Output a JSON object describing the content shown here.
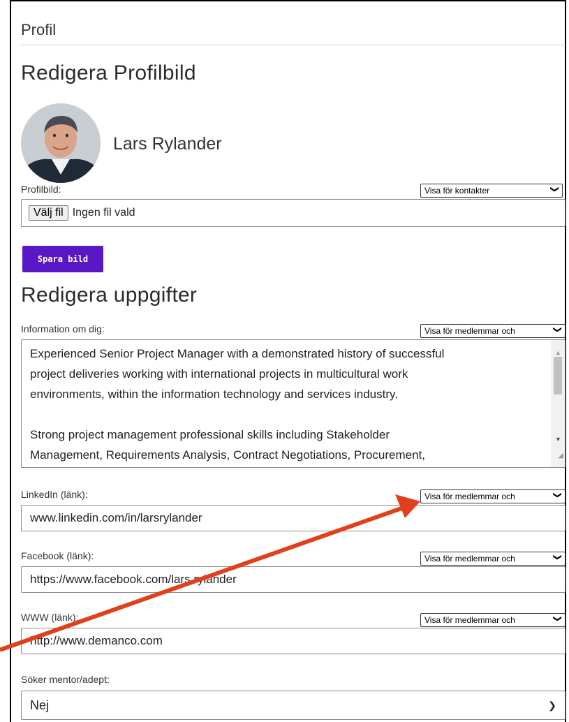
{
  "page": {
    "tab_title": "Profil"
  },
  "photo_section": {
    "heading": "Redigera Profilbild",
    "user_name": "Lars Rylander",
    "label": "Profilbild:",
    "visibility": "Visa för kontakter",
    "file_button": "Välj fil",
    "file_status": "Ingen fil vald",
    "save_button": "Spara bild"
  },
  "details_section": {
    "heading": "Redigera uppgifter",
    "about": {
      "label": "Information om dig:",
      "visibility": "Visa för medlemmar och",
      "lines": [
        "Experienced Senior Project Manager with a demonstrated history of successful",
        "project deliveries working with international projects in multicultural work",
        "environments, within the information technology and services industry.",
        "",
        "Strong project management professional skills including Stakeholder",
        "Management, Requirements Analysis, Contract Negotiations, Procurement,"
      ]
    },
    "linkedin": {
      "label": "LinkedIn (länk):",
      "visibility": "Visa för medlemmar och",
      "value": "www.linkedin.com/in/larsrylander"
    },
    "facebook": {
      "label": "Facebook (länk):",
      "visibility": "Visa för medlemmar och",
      "value": "https://www.facebook.com/lars.rylander"
    },
    "www": {
      "label": "WWW (länk):",
      "visibility": "Visa för medlemmar och",
      "value": "http://www.demanco.com"
    },
    "mentor": {
      "label": "Söker mentor/adept:",
      "value": "Nej"
    }
  },
  "colors": {
    "save_button_bg": "#5a17c6",
    "annotation_arrow": "#e0401c"
  },
  "icons": {
    "dropdown": "chevron-down-icon",
    "annotation": "annotation-arrow-icon"
  }
}
